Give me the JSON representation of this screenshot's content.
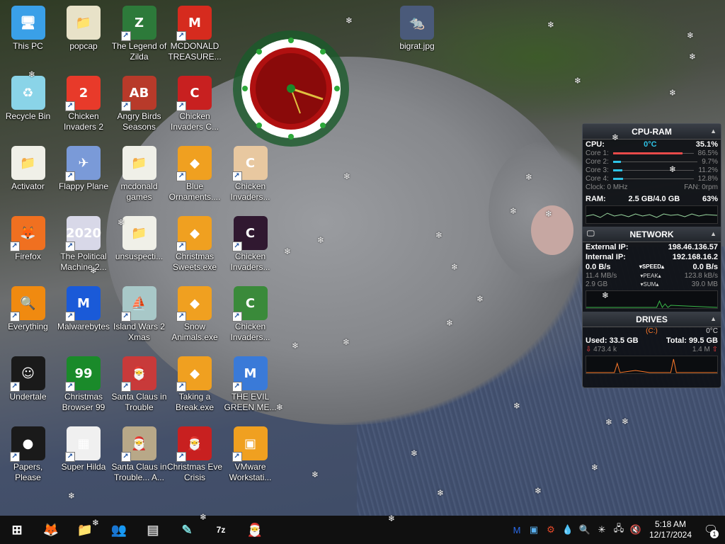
{
  "desktop": {
    "icons": [
      {
        "label": "This PC",
        "col": 0,
        "row": 0,
        "color": "#3aa0e8",
        "glyph": "🖥",
        "shortcut": false
      },
      {
        "label": "popcap",
        "col": 1,
        "row": 0,
        "color": "#e8e2c8",
        "glyph": "📁",
        "shortcut": false
      },
      {
        "label": "The Legend of Zilda",
        "col": 2,
        "row": 0,
        "color": "#2d7a3a",
        "glyph": "Z",
        "shortcut": true
      },
      {
        "label": "MCDONALD TREASURE...",
        "col": 3,
        "row": 0,
        "color": "#d62b1e",
        "glyph": "M",
        "shortcut": true
      },
      {
        "label": "bigrat.jpg",
        "col": 7,
        "row": 0,
        "color": "#4a5a7a",
        "glyph": "🐀",
        "shortcut": false
      },
      {
        "label": "Recycle Bin",
        "col": 0,
        "row": 1,
        "color": "#8ad4e8",
        "glyph": "♻",
        "shortcut": false
      },
      {
        "label": "Chicken Invaders 2",
        "col": 1,
        "row": 1,
        "color": "#e83a2a",
        "glyph": "2",
        "shortcut": true
      },
      {
        "label": "Angry Birds Seasons",
        "col": 2,
        "row": 1,
        "color": "#b83a2a",
        "glyph": "AB",
        "shortcut": true
      },
      {
        "label": "Chicken Invaders C...",
        "col": 3,
        "row": 1,
        "color": "#c82020",
        "glyph": "C",
        "shortcut": true
      },
      {
        "label": "Activator",
        "col": 0,
        "row": 2,
        "color": "#f0f0e8",
        "glyph": "📁",
        "shortcut": false
      },
      {
        "label": "Flappy Plane",
        "col": 1,
        "row": 2,
        "color": "#7a9ad8",
        "glyph": "✈",
        "shortcut": true
      },
      {
        "label": "mcdonald games",
        "col": 2,
        "row": 2,
        "color": "#f0f0e8",
        "glyph": "📁",
        "shortcut": false
      },
      {
        "label": "Blue Ornaments....",
        "col": 3,
        "row": 2,
        "color": "#f0a020",
        "glyph": "◆",
        "shortcut": true
      },
      {
        "label": "Chicken Invaders...",
        "col": 4,
        "row": 2,
        "color": "#e8c8a0",
        "glyph": "C",
        "shortcut": true
      },
      {
        "label": "Firefox",
        "col": 0,
        "row": 3,
        "color": "#f07020",
        "glyph": "🦊",
        "shortcut": true
      },
      {
        "label": "The Political Machine 2...",
        "col": 1,
        "row": 3,
        "color": "#d8d8e8",
        "glyph": "2020",
        "shortcut": true
      },
      {
        "label": "unsuspecti...",
        "col": 2,
        "row": 3,
        "color": "#f0f0e8",
        "glyph": "📁",
        "shortcut": false
      },
      {
        "label": "Christmas Sweets.exe",
        "col": 3,
        "row": 3,
        "color": "#f0a020",
        "glyph": "◆",
        "shortcut": true
      },
      {
        "label": "Chicken Invaders...",
        "col": 4,
        "row": 3,
        "color": "#301830",
        "glyph": "C",
        "shortcut": true
      },
      {
        "label": "Everything",
        "col": 0,
        "row": 4,
        "color": "#f08a10",
        "glyph": "🔍",
        "shortcut": true
      },
      {
        "label": "Malwarebytes",
        "col": 1,
        "row": 4,
        "color": "#1a5ad8",
        "glyph": "M",
        "shortcut": true
      },
      {
        "label": "Island Wars 2 Xmas",
        "col": 2,
        "row": 4,
        "color": "#a8c8c8",
        "glyph": "⛵",
        "shortcut": true
      },
      {
        "label": "Snow Animals.exe",
        "col": 3,
        "row": 4,
        "color": "#f0a020",
        "glyph": "◆",
        "shortcut": true
      },
      {
        "label": "Chicken Invaders...",
        "col": 4,
        "row": 4,
        "color": "#3a8a3a",
        "glyph": "C",
        "shortcut": true
      },
      {
        "label": "Undertale",
        "col": 0,
        "row": 5,
        "color": "#1a1a1a",
        "glyph": "☺",
        "shortcut": true
      },
      {
        "label": "Christmas Browser 99",
        "col": 1,
        "row": 5,
        "color": "#1a8a2a",
        "glyph": "99",
        "shortcut": true
      },
      {
        "label": "Santa Claus in Trouble",
        "col": 2,
        "row": 5,
        "color": "#c83a3a",
        "glyph": "🎅",
        "shortcut": true
      },
      {
        "label": "Taking a Break.exe",
        "col": 3,
        "row": 5,
        "color": "#f0a020",
        "glyph": "◆",
        "shortcut": true
      },
      {
        "label": "THE EVIL GREEN ME...",
        "col": 4,
        "row": 5,
        "color": "#3a7ad8",
        "glyph": "M",
        "shortcut": true
      },
      {
        "label": "Papers, Please",
        "col": 0,
        "row": 6,
        "color": "#1a1a1a",
        "glyph": "●",
        "shortcut": true
      },
      {
        "label": "Super Hilda",
        "col": 1,
        "row": 6,
        "color": "#f0f0f0",
        "glyph": "▦",
        "shortcut": true
      },
      {
        "label": "Santa Claus in Trouble... A...",
        "col": 2,
        "row": 6,
        "color": "#b8a888",
        "glyph": "🎅",
        "shortcut": true
      },
      {
        "label": "Christmas Eve Crisis",
        "col": 3,
        "row": 6,
        "color": "#c82020",
        "glyph": "🎅",
        "shortcut": true
      },
      {
        "label": "VMware Workstati...",
        "col": 4,
        "row": 6,
        "color": "#f0a020",
        "glyph": "▣",
        "shortcut": true
      }
    ]
  },
  "monitor": {
    "cpu_ram": {
      "title": "CPU-RAM",
      "cpu_label": "CPU:",
      "cpu_temp": "0°C",
      "cpu_pct": "35.1%",
      "cores": [
        {
          "label": "Core 1:",
          "value": "86.5%",
          "fill": 0.865
        },
        {
          "label": "Core 2:",
          "value": "9.7%",
          "fill": 0.097
        },
        {
          "label": "Core 3:",
          "value": "11.2%",
          "fill": 0.112
        },
        {
          "label": "Core 4:",
          "value": "12.8%",
          "fill": 0.128
        }
      ],
      "clock": "Clock: 0 MHz",
      "fan": "FAN: 0rpm",
      "ram_label": "RAM:",
      "ram_used": "2.5 GB/4.0 GB",
      "ram_pct": "63%"
    },
    "network": {
      "title": "NETWORK",
      "external_label": "External IP:",
      "external_ip": "198.46.136.57",
      "internal_label": "Internal IP:",
      "internal_ip": "192.168.16.2",
      "speed_down": "0.0 B/s",
      "speed_label": "▾SPEED▴",
      "speed_up": "0.0 B/s",
      "peak_down": "11.4 MB/s",
      "peak_label": "▾PEAK▴",
      "peak_up": "123.8 kB/s",
      "sum_down": "2.9 GB",
      "sum_label": "▾SUM▴",
      "sum_up": "39.0 MB"
    },
    "drives": {
      "title": "DRIVES",
      "drive": "(C:)",
      "temp": "0°C",
      "used_label": "Used:",
      "used": "33.5 GB",
      "total_label": "Total:",
      "total": "99.5 GB",
      "read": "473.4 k",
      "write": "1.4 M"
    }
  },
  "taskbar": {
    "apps": [
      {
        "name": "start",
        "glyph": "⊞",
        "color": "#ffffff"
      },
      {
        "name": "firefox",
        "glyph": "🦊",
        "color": "#f07020"
      },
      {
        "name": "file-explorer",
        "glyph": "📁",
        "color": "#f0c040"
      },
      {
        "name": "app-people",
        "glyph": "👥",
        "color": "#5a9ad8"
      },
      {
        "name": "app-window",
        "glyph": "▤",
        "color": "#c8c8c8"
      },
      {
        "name": "app-notepad",
        "glyph": "✎",
        "color": "#7ad8d8"
      },
      {
        "name": "7zip",
        "glyph": "7z",
        "color": "#ffffff"
      },
      {
        "name": "santa-game",
        "glyph": "🎅",
        "color": "#d83a3a"
      }
    ],
    "tray": [
      {
        "name": "malwarebytes-tray",
        "glyph": "M",
        "color": "#2a6ae8"
      },
      {
        "name": "monitor-tray",
        "glyph": "▣",
        "color": "#5ab0f0"
      },
      {
        "name": "app-tray",
        "glyph": "⚙",
        "color": "#e84a2a"
      },
      {
        "name": "drop-tray",
        "glyph": "💧",
        "color": "#a8d8f8"
      },
      {
        "name": "everything-tray",
        "glyph": "🔍",
        "color": "#f08a10"
      },
      {
        "name": "snow-tray",
        "glyph": "✳",
        "color": "#ffffff"
      },
      {
        "name": "network-tray",
        "glyph": "🖧",
        "color": "#e8e8e8"
      },
      {
        "name": "volume-tray",
        "glyph": "🔇",
        "color": "#e8e8e8"
      }
    ],
    "time": "5:18 AM",
    "date": "12/17/2024",
    "notification_count": "1"
  }
}
